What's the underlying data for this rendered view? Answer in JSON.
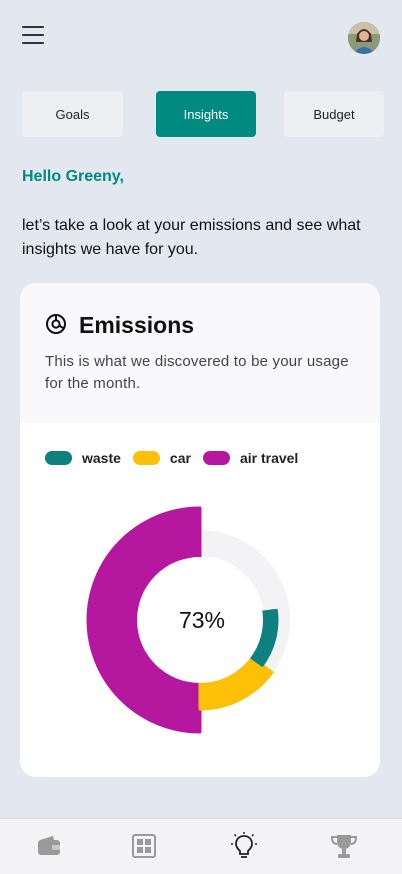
{
  "header": {
    "menu_icon": "hamburger-menu-icon",
    "avatar": "user-avatar"
  },
  "tabs": [
    {
      "label": "Goals",
      "active": false
    },
    {
      "label": "Insights",
      "active": true
    },
    {
      "label": "Budget",
      "active": false
    }
  ],
  "greeting": "Hello Greeny,",
  "intro": "let’s take a look at your emissions and see what insights we have for you.",
  "card": {
    "icon": "donut-chart-icon",
    "title": "Emissions",
    "description": "This is what we discovered to be your usage for the month."
  },
  "colors": {
    "accent": "#008a80",
    "waste": "#0f8080",
    "car": "#fcc107",
    "air_travel": "#b5179e",
    "track": "#f3f3f5"
  },
  "chart_data": {
    "type": "pie",
    "center_label": "73%",
    "legend": [
      "waste",
      "car",
      "air travel"
    ],
    "series": [
      {
        "name": "waste",
        "value": 12
      },
      {
        "name": "car",
        "value": 15
      },
      {
        "name": "air travel",
        "value": 50
      }
    ],
    "total": 100,
    "legend_placement": "top-left"
  },
  "bottom_nav": [
    {
      "icon": "wallet-icon",
      "active": false
    },
    {
      "icon": "grid-icon",
      "active": false
    },
    {
      "icon": "lightbulb-icon",
      "active": true
    },
    {
      "icon": "trophy-icon",
      "active": false
    }
  ]
}
